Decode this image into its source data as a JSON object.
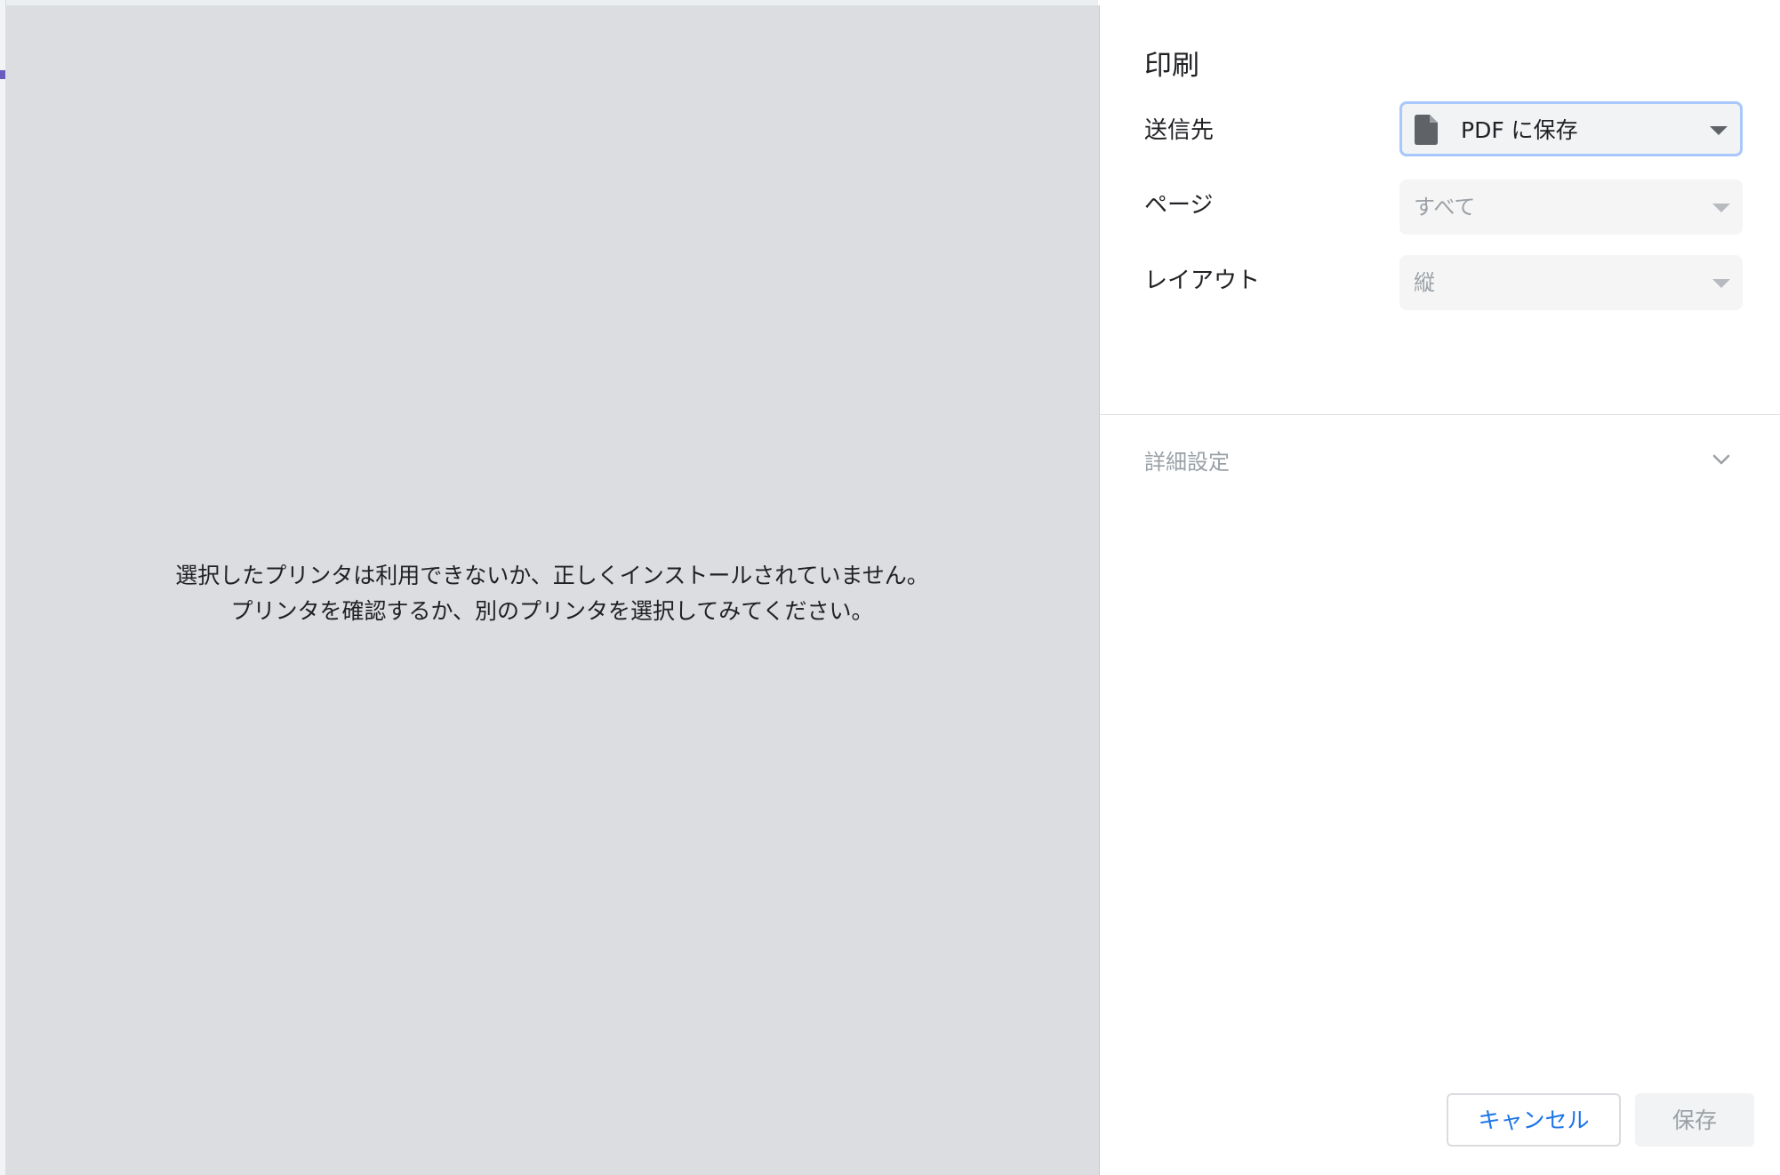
{
  "preview": {
    "message_line1": "選択したプリンタは利用できないか、正しくインストールされていません。",
    "message_line2": "プリンタを確認するか、別のプリンタを選択してみてください。"
  },
  "panel": {
    "title": "印刷",
    "destination": {
      "label": "送信先",
      "value": "PDF に保存",
      "icon": "file-icon"
    },
    "pages": {
      "label": "ページ",
      "value": "すべて"
    },
    "layout": {
      "label": "レイアウト",
      "value": "縦"
    },
    "advanced_label": "詳細設定",
    "buttons": {
      "cancel": "キャンセル",
      "save": "保存"
    }
  },
  "colors": {
    "accent": "#1a73e8",
    "preview_bg": "#dcdde0",
    "focus_ring": "#a8c7fa",
    "disabled_text": "#9aa0a6"
  }
}
